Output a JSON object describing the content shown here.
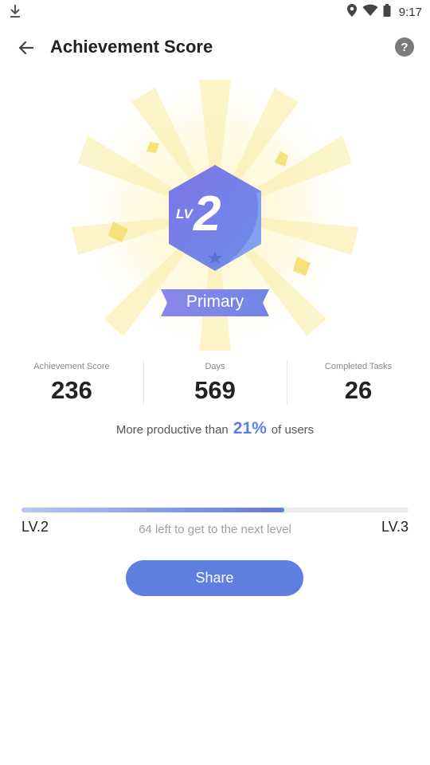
{
  "status_bar": {
    "time": "9:17"
  },
  "header": {
    "title": "Achievement Score",
    "help_label": "?"
  },
  "badge": {
    "prefix": "LV",
    "level": "2",
    "rank": "Primary"
  },
  "stats": [
    {
      "label": "Achievement Score",
      "value": "236"
    },
    {
      "label": "Days",
      "value": "569"
    },
    {
      "label": "Completed Tasks",
      "value": "26"
    }
  ],
  "compare": {
    "before": "More productive than",
    "percent": "21%",
    "after": "of users"
  },
  "progress": {
    "current_level": "LV.2",
    "next_level": "LV.3",
    "hint": "64 left to get to the next level",
    "fraction": 0.68
  },
  "share_label": "Share",
  "colors": {
    "accent": "#5f7fe0",
    "badge": "#7b84e8",
    "star": "#f7e27a"
  }
}
